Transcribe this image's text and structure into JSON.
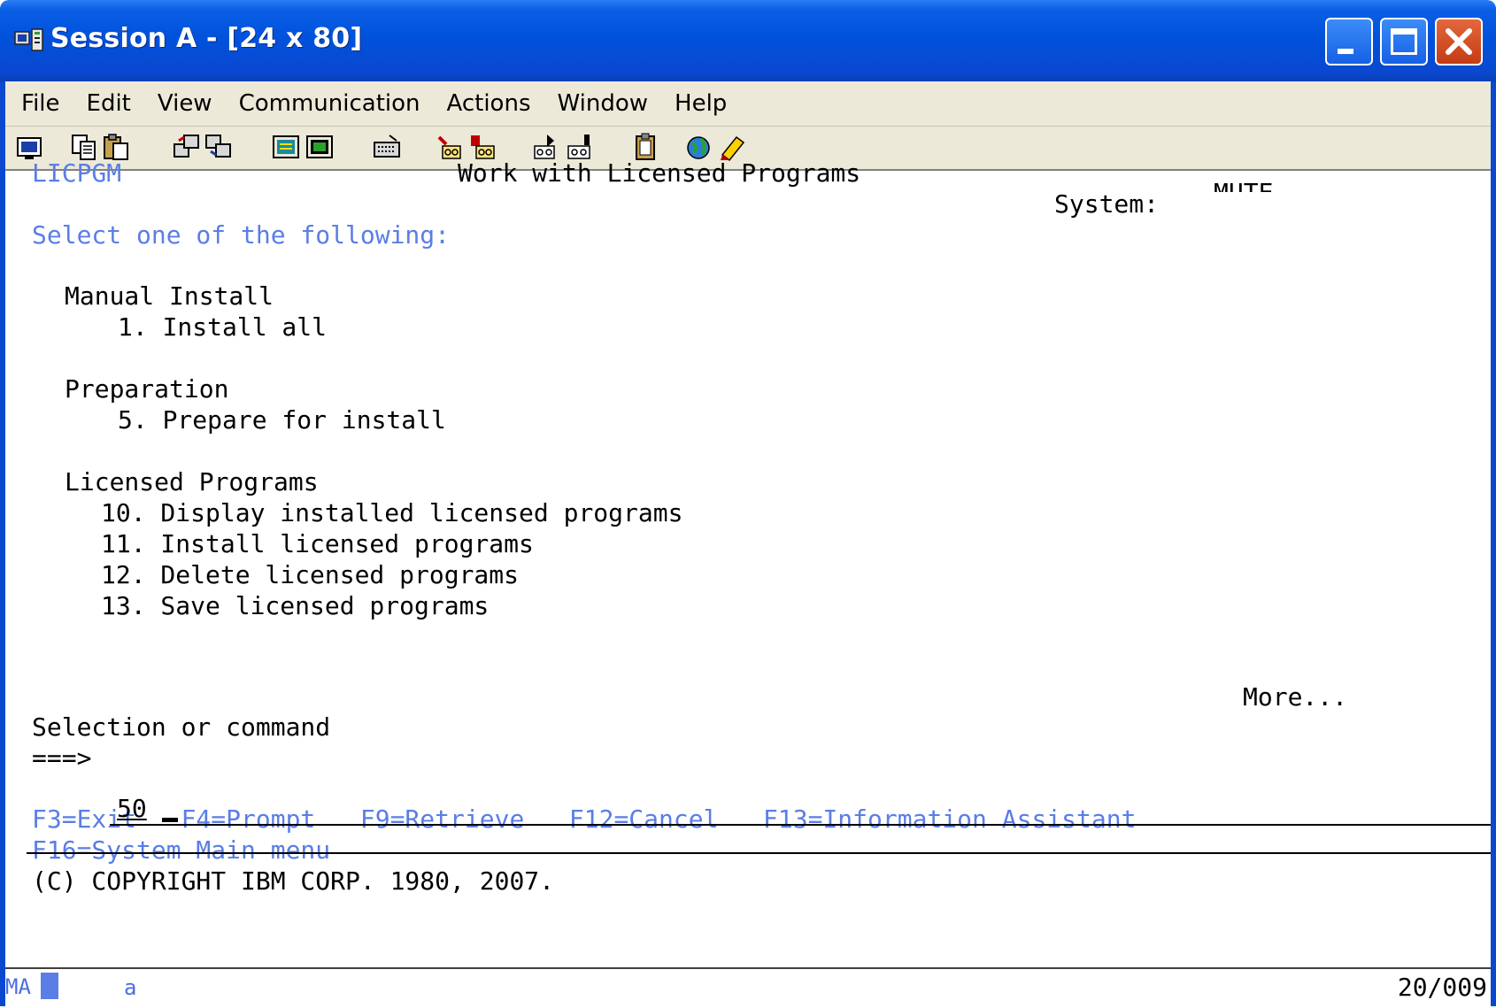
{
  "window": {
    "title": "Session A - [24 x 80]"
  },
  "menu": {
    "items": [
      "File",
      "Edit",
      "View",
      "Communication",
      "Actions",
      "Window",
      "Help"
    ]
  },
  "toolbar": {
    "icons": [
      "print-screen-icon",
      "copy-icon",
      "paste-icon",
      "send-file-icon",
      "receive-file-icon",
      "display-icon",
      "keypad-icon",
      "macro-icon",
      "record-macro-icon",
      "stop-macro-icon",
      "play-macro-icon",
      "play-macro-2-icon",
      "clipboard-icon",
      "web-icon",
      "help-icon"
    ]
  },
  "screen": {
    "program_id": "LICPGM",
    "title": "Work with Licensed Programs",
    "system_label": "System:",
    "system_value": "MUTE",
    "prompt": "Select one of the following:",
    "groups": [
      {
        "heading": "Manual Install",
        "options": [
          "1. Install all"
        ]
      },
      {
        "heading": "Preparation",
        "options": [
          "5. Prepare for install"
        ]
      },
      {
        "heading": "Licensed Programs",
        "options": [
          "10. Display installed licensed programs",
          "11. Install licensed programs",
          "12. Delete licensed programs",
          "13. Save licensed programs"
        ]
      }
    ],
    "more": "More...",
    "command_label": "Selection or command",
    "command_arrow": "===>",
    "command_value": "50",
    "fkeys_line1": "F3=Exit   F4=Prompt   F9=Retrieve   F12=Cancel   F13=Information Assistant",
    "fkeys_line2": "F16=System Main menu",
    "copyright": "(C) COPYRIGHT IBM CORP. 1980, 2007."
  },
  "status": {
    "indicator": "MA",
    "mode": "a",
    "cursor_position": "20/009"
  }
}
